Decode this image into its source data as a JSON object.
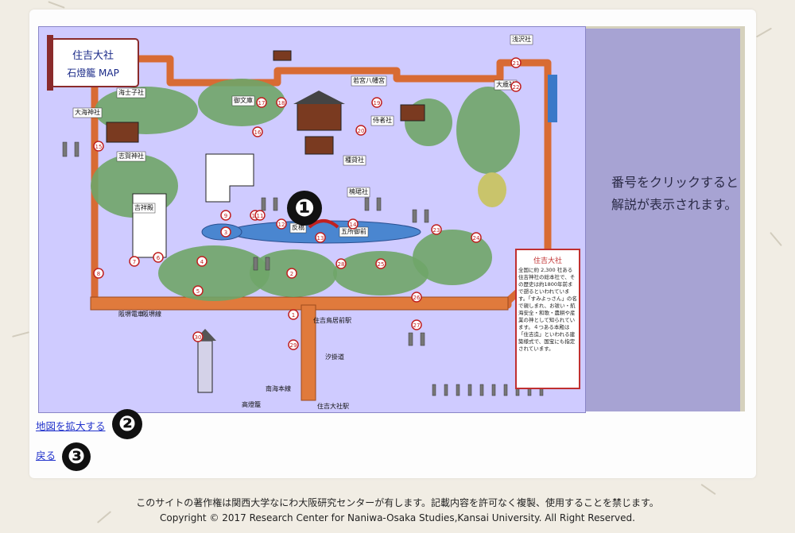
{
  "map": {
    "title_name": "住吉大社",
    "title_sub": "石燈籠 MAP",
    "shrine_labels": [
      "大海神社",
      "浅沢社",
      "大歳社",
      "若宮八幡宮",
      "侍者社",
      "楠珺社",
      "種貸社",
      "五所御前",
      "住吉大社",
      "吉祥殿",
      "海士子社",
      "志賀神社",
      "御文庫",
      "反橋"
    ],
    "places": [
      "阪堺電車",
      "阪堺線",
      "南海本線",
      "住吉大社駅",
      "住吉鳥居前駅",
      "汐掛道",
      "高燈籠",
      "住吉大社"
    ],
    "pins": [
      "1",
      "2",
      "3",
      "4",
      "5",
      "6",
      "7",
      "8",
      "9",
      "10",
      "11",
      "12",
      "13",
      "14",
      "15",
      "16",
      "17",
      "18",
      "19",
      "20",
      "21",
      "22",
      "23",
      "24",
      "25",
      "26",
      "27",
      "28",
      "29",
      "30"
    ],
    "note_title": "住吉大社",
    "note_body": "全国に約 2,300 社ある住吉神社の総本社で、その歴史は約1800年前まで遡るといわれています。「すみよっさん」の名で親しまれ、お祓い・航海安全・和歌・農耕や産業の神として知られています。４つある本殿は「住吉造」といわれる建築様式で、国宝にも指定されています。"
  },
  "side": {
    "hint": "番号をクリックすると\n解説が表示されます。"
  },
  "markers": {
    "m1": "❶",
    "m2": "❷",
    "m3": "❸"
  },
  "links": {
    "enlarge": "地図を拡大する",
    "back": "戻る"
  },
  "footer": {
    "line1": "このサイトの著作権は関西大学なにわ大阪研究センターが有します。記載内容を許可なく複製、使用することを禁じます。",
    "line2": "Copyright © 2017 Research Center for Naniwa-Osaka Studies,Kansai University. All Right Reserved."
  }
}
